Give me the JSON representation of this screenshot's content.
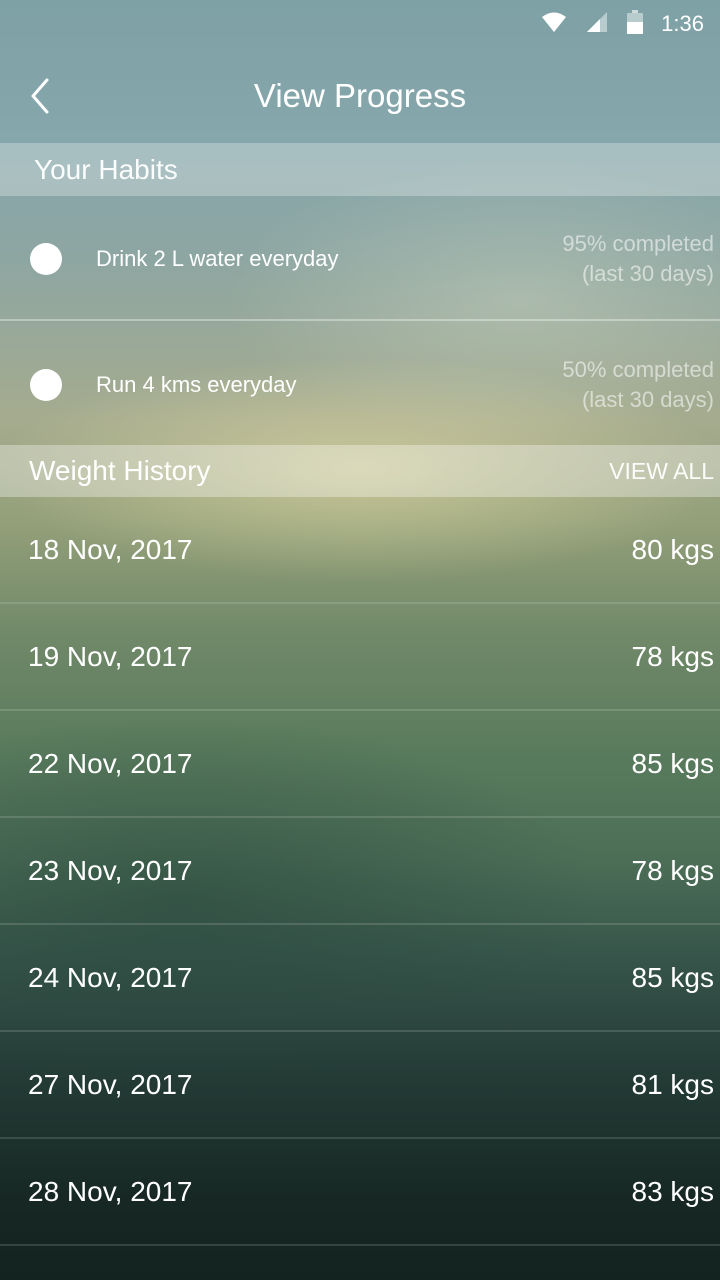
{
  "status_bar": {
    "time": "1:36",
    "icons": [
      "wifi-icon",
      "signal-icon",
      "battery-icon"
    ]
  },
  "toolbar": {
    "back_icon": "chevron-left-icon",
    "title": "View Progress"
  },
  "habits": {
    "header": "Your Habits",
    "items": [
      {
        "name": "Drink 2 L water everyday",
        "completed": "95% completed",
        "period": "(last 30 days)"
      },
      {
        "name": "Run 4 kms everyday",
        "completed": "50% completed",
        "period": "(last 30 days)"
      }
    ]
  },
  "weight_history": {
    "header": "Weight History",
    "view_all": "VIEW ALL",
    "rows": [
      {
        "date": "18 Nov, 2017",
        "weight": "80 kgs"
      },
      {
        "date": "19 Nov, 2017",
        "weight": "78 kgs"
      },
      {
        "date": "22 Nov, 2017",
        "weight": "85 kgs"
      },
      {
        "date": "23 Nov, 2017",
        "weight": "78 kgs"
      },
      {
        "date": "24 Nov, 2017",
        "weight": "85 kgs"
      },
      {
        "date": "27 Nov, 2017",
        "weight": "81 kgs"
      },
      {
        "date": "28 Nov, 2017",
        "weight": "83 kgs"
      }
    ]
  }
}
